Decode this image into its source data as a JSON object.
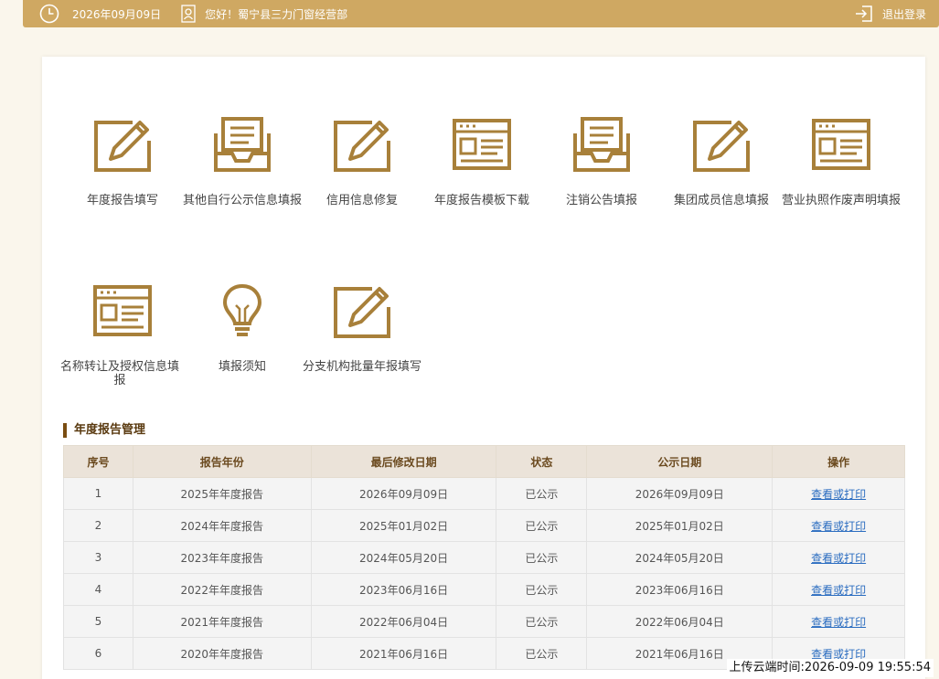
{
  "header": {
    "date": "2026年09月09日",
    "greeting": "您好！蜀宁县三力门窗经营部",
    "logout": "退出登录"
  },
  "tiles": [
    {
      "label": "年度报告填写",
      "icon": "edit-icon"
    },
    {
      "label": "其他自行公示信息填报",
      "icon": "inbox-icon"
    },
    {
      "label": "信用信息修复",
      "icon": "edit-icon"
    },
    {
      "label": "年度报告模板下载",
      "icon": "window-icon"
    },
    {
      "label": "注销公告填报",
      "icon": "inbox-icon"
    },
    {
      "label": "集团成员信息填报",
      "icon": "edit-icon"
    },
    {
      "label": "营业执照作废声明填报",
      "icon": "window-icon"
    },
    {
      "label": "名称转让及授权信息填报",
      "icon": "window-icon"
    },
    {
      "label": "填报须知",
      "icon": "lightbulb-icon"
    },
    {
      "label": "分支机构批量年报填写",
      "icon": "edit-icon"
    }
  ],
  "section": {
    "title": "年度报告管理"
  },
  "table": {
    "headers": [
      "序号",
      "报告年份",
      "最后修改日期",
      "状态",
      "公示日期",
      "操作"
    ],
    "rows": [
      [
        "1",
        "2025年年度报告",
        "2026年09月09日",
        "已公示",
        "2026年09月09日",
        "查看或打印"
      ],
      [
        "2",
        "2024年年度报告",
        "2025年01月02日",
        "已公示",
        "2025年01月02日",
        "查看或打印"
      ],
      [
        "3",
        "2023年年度报告",
        "2024年05月20日",
        "已公示",
        "2024年05月20日",
        "查看或打印"
      ],
      [
        "4",
        "2022年年度报告",
        "2023年06月16日",
        "已公示",
        "2023年06月16日",
        "查看或打印"
      ],
      [
        "5",
        "2021年年度报告",
        "2022年06月04日",
        "已公示",
        "2022年06月04日",
        "查看或打印"
      ],
      [
        "6",
        "2020年年度报告",
        "2021年06月16日",
        "已公示",
        "2021年06月16日",
        "查看或打印"
      ]
    ]
  },
  "footer": {
    "upload_time": "上传云端时间:2026-09-09 19:55:54"
  },
  "colors": {
    "accent": "#cfa862",
    "icon": "#a8803a"
  }
}
